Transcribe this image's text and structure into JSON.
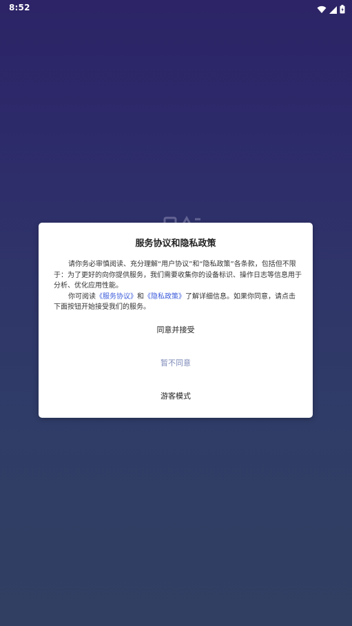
{
  "status_bar": {
    "time": "8:52",
    "icons": [
      "wifi-icon",
      "signal-icon",
      "battery-icon"
    ]
  },
  "dialog": {
    "title": "服务协议和隐私政策",
    "paragraph1": "请你务必审慎阅读、充分理解“用户协议”和“隐私政策”各条款，包括但不限于：为了更好的向你提供服务，我们需要收集你的设备标识、操作日志等信息用于分析、优化应用性能。",
    "paragraph2_prefix": "你可阅读",
    "link_service": "《服务协议》",
    "paragraph2_and": "和",
    "link_privacy": "《隐私政策》",
    "paragraph2_suffix": "了解详细信息。如果你同意，请点击下面按钮开始接受我们的服务。",
    "agree_button": "同意并接受",
    "disagree_button": "暂不同意",
    "guest_button": "游客模式"
  },
  "colors": {
    "link": "#3b5bdb",
    "disagree": "#7d8ab8",
    "background_top": "#2c2466",
    "background_bottom": "#313f62"
  }
}
